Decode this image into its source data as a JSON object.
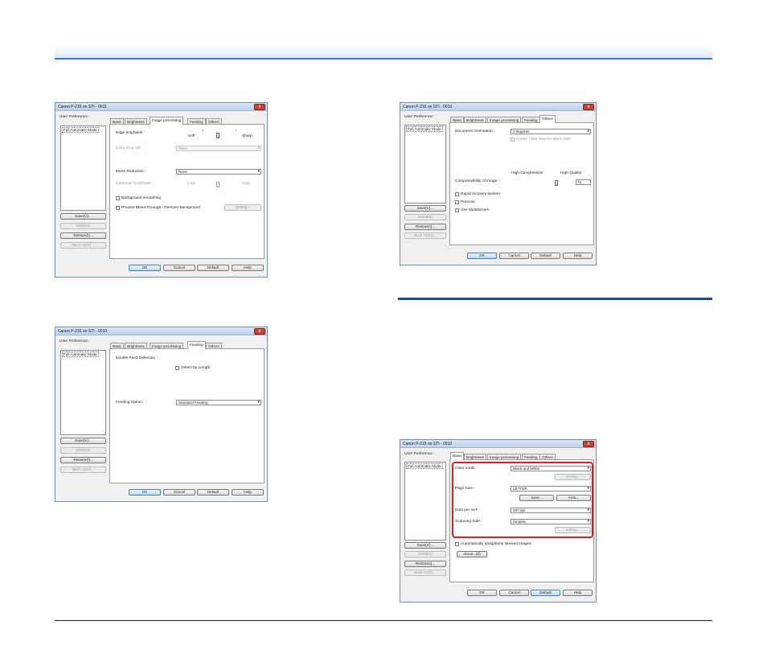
{
  "dialog_title": "Canon P-215 on STI - 0011",
  "dialog_title_b": "Canon P-215 on STI - 0010",
  "user_pref_label": "User Preference :",
  "list_item": "Full Automatic Mode",
  "side_buttons": {
    "save": "Save(V)...",
    "delete": "Delete(I)",
    "restore": "Restore(I)...",
    "backup": "Back Up(X)..."
  },
  "tabs": {
    "basic": "Basic",
    "brightness": "Brightness",
    "image_processing": "Image processing",
    "feeding": "Feeding",
    "others": "Others"
  },
  "bottom_buttons": {
    "ok": "OK",
    "cancel": "Cancel",
    "default": "Default",
    "help": "Help"
  },
  "close_glyph": "x",
  "image_proc": {
    "edge_emphasis": "Edge emphasis :",
    "soft": "Soft",
    "sharp": "Sharp",
    "color_drop_out": "Color drop out :",
    "color_drop_value": "None",
    "moire_reduction": "Moire Reduction :",
    "moire_value": "None",
    "character_emphasis": "Character Emphasis :",
    "low": "Low",
    "high": "High",
    "background_smoothing": "Background smoothing",
    "prevent_bleed": "Prevent Bleed Through / Remove Background",
    "setting": "Setting..."
  },
  "feeding": {
    "double_feed": "Double Feed Detection :",
    "detect_by_length": "Detect by Length",
    "feeding_option": "Feeding Option :",
    "feeding_value": "Standard Feeding"
  },
  "others": {
    "doc_orientation": "Document Orientation :",
    "orientation_value": "0 degrees",
    "rotate_back": "Rotate +180 degrees Back Side",
    "high_compression": "High Compression",
    "high_quality": "High Quality",
    "compressibility": "Compressibility of image :",
    "compress_value": "75",
    "rapid_recovery": "Rapid recovery system",
    "prescan": "Prescan",
    "use_multistream": "Use MultiStream"
  },
  "basic": {
    "color_mode": "Color mode :",
    "color_value": "Black and White",
    "setting": "Setting...",
    "page_size": "Page Size :",
    "page_value": "LETTER",
    "save": "Save...",
    "area": "Area...",
    "dpi": "Dots per inch :",
    "dpi_value": "200 dpi",
    "scanning_side": "Scanning Side :",
    "side_value": "Simplex",
    "auto_straighten": "Automatically straightens skewed images",
    "about": "About...(Z)"
  },
  "colors": {
    "highlight": "#d31f27",
    "rule": "#3a78c4",
    "section_rule": "#1b4f8f"
  }
}
